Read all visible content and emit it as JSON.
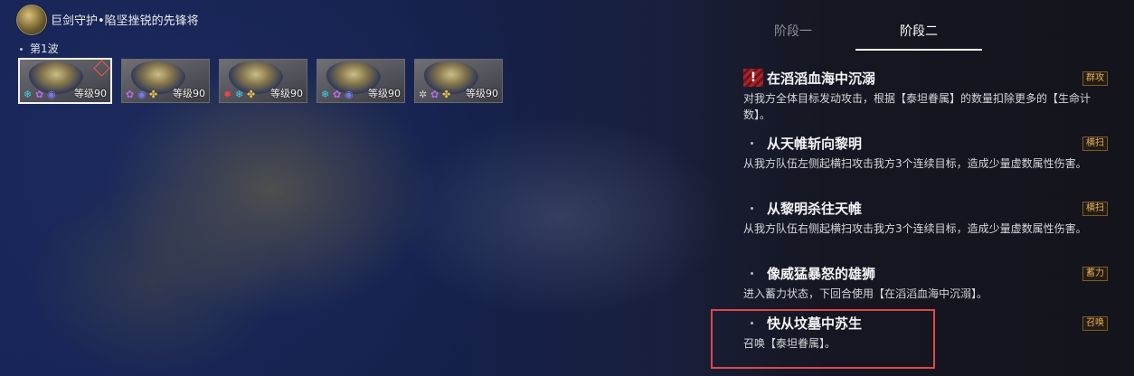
{
  "header": {
    "title": "巨剑守护•陷坚挫锐的先锋将",
    "wave_label": "第1波"
  },
  "units": [
    {
      "level": "等级90",
      "selected": true
    },
    {
      "level": "等级90",
      "selected": false
    },
    {
      "level": "等级90",
      "selected": false
    },
    {
      "level": "等级90",
      "selected": false
    },
    {
      "level": "等级90",
      "selected": false
    }
  ],
  "tabs": [
    {
      "label": "阶段一",
      "active": false
    },
    {
      "label": "阶段二",
      "active": true
    }
  ],
  "skills": [
    {
      "name": "在滔滔血海中沉溺",
      "tag": "群攻",
      "warning": "!",
      "desc": "对我方全体目标发动攻击，根据【泰坦眷属】的数量扣除更多的【生命计数】。"
    },
    {
      "name": "从天帷斩向黎明",
      "tag": "横扫",
      "desc": "从我方队伍左侧起横扫攻击我方3个连续目标，造成少量虚数属性伤害。"
    },
    {
      "name": "从黎明杀往天帷",
      "tag": "横扫",
      "desc": "从我方队伍右侧起横扫攻击我方3个连续目标，造成少量虚数属性伤害。"
    },
    {
      "name": "像威猛暴怒的雄狮",
      "tag": "蓄力",
      "desc": "进入蓄力状态，下回合使用【在滔滔血海中沉溺】。"
    },
    {
      "name": "快从坟墓中苏生",
      "tag": "召唤",
      "desc": "召唤【泰坦眷属】。"
    }
  ],
  "colors": {
    "tag_text": "#e8b258",
    "highlight_box": "#e04848",
    "warning_bg": "#a8242a"
  },
  "icons": [
    "snowflake-icon",
    "lotus-icon",
    "orb-icon",
    "fleur-icon",
    "flame-icon",
    "ring-icon"
  ]
}
